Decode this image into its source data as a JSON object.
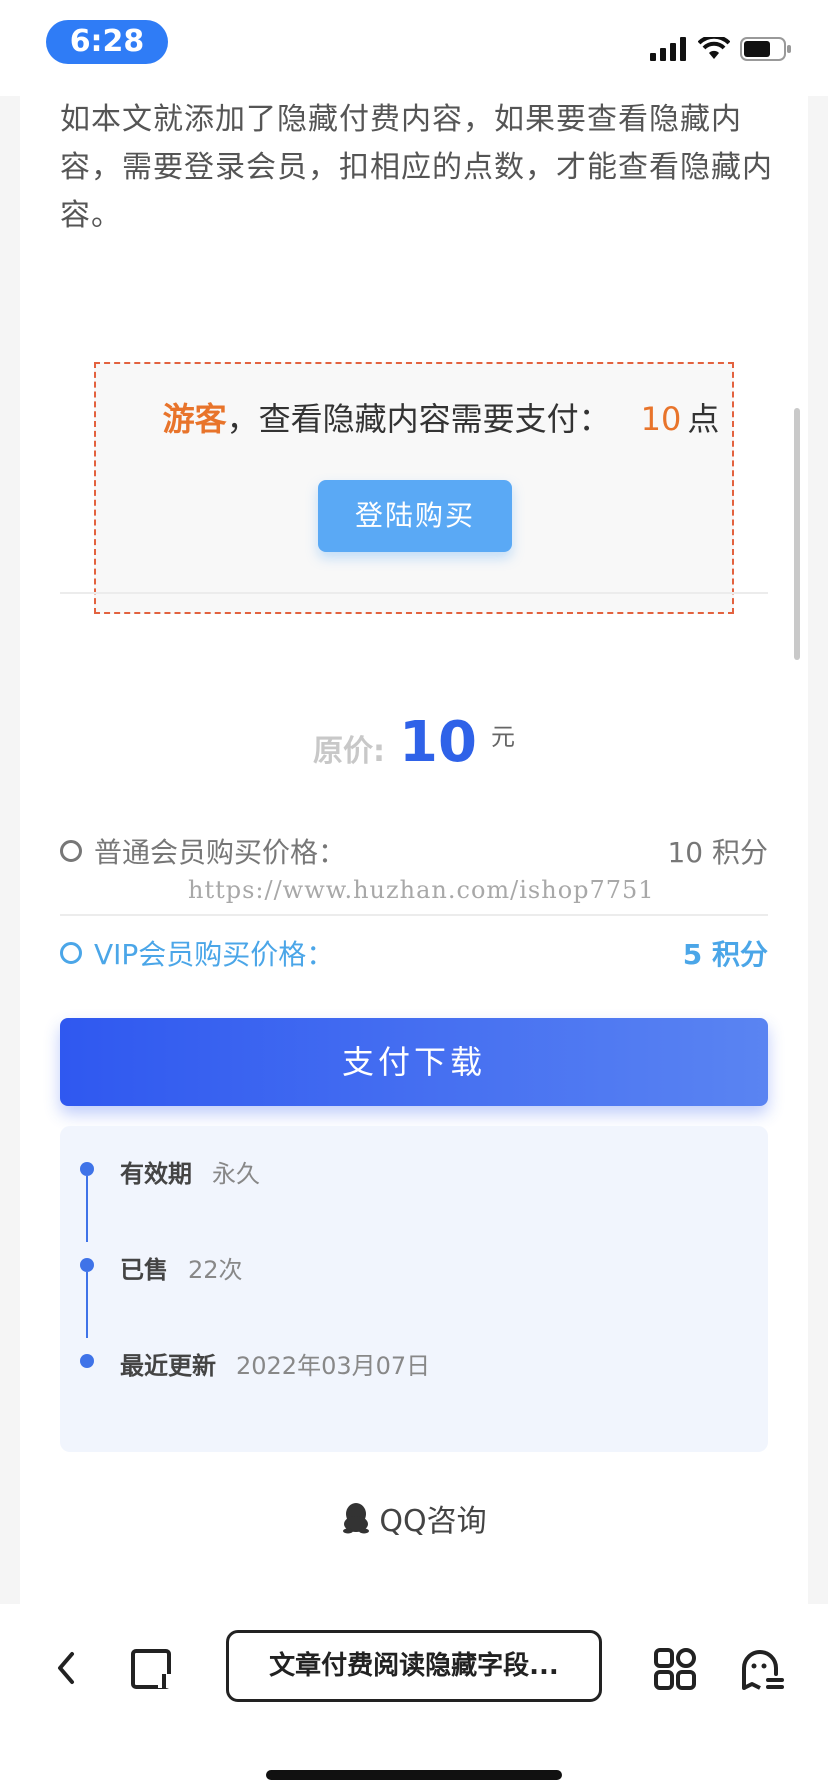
{
  "status_bar": {
    "time": "6:28"
  },
  "article": {
    "intro": "如本文就添加了隐藏付费内容，如果要查看隐藏内容，需要登录会员，扣相应的点数，才能查看隐藏内容。"
  },
  "hidden_content": {
    "guest_label": "游客",
    "message": "，查看隐藏内容需要支付：",
    "points": "10",
    "points_unit": "点",
    "login_button": "登陆购买"
  },
  "price": {
    "label": "原价:",
    "value": "10",
    "unit": "元"
  },
  "members": {
    "normal_label": "普通会员购买价格：",
    "normal_price": "10 积分",
    "vip_label": "VIP会员购买价格：",
    "vip_price": "5 积分"
  },
  "watermark": "https://www.huzhan.com/ishop7751",
  "pay_button": "支付下载",
  "info": [
    {
      "label": "有效期",
      "value": "永久"
    },
    {
      "label": "已售",
      "value": "22次"
    },
    {
      "label": "最近更新",
      "value": "2022年03月07日"
    }
  ],
  "qq_consult": "QQ咨询",
  "browser": {
    "address": "文章付费阅读隐藏字段..."
  },
  "colors": {
    "accent_blue": "#2f62e8",
    "guest_orange": "#e8742b",
    "vip_blue": "#4ba6e8",
    "login_button": "#5aa9f5"
  }
}
